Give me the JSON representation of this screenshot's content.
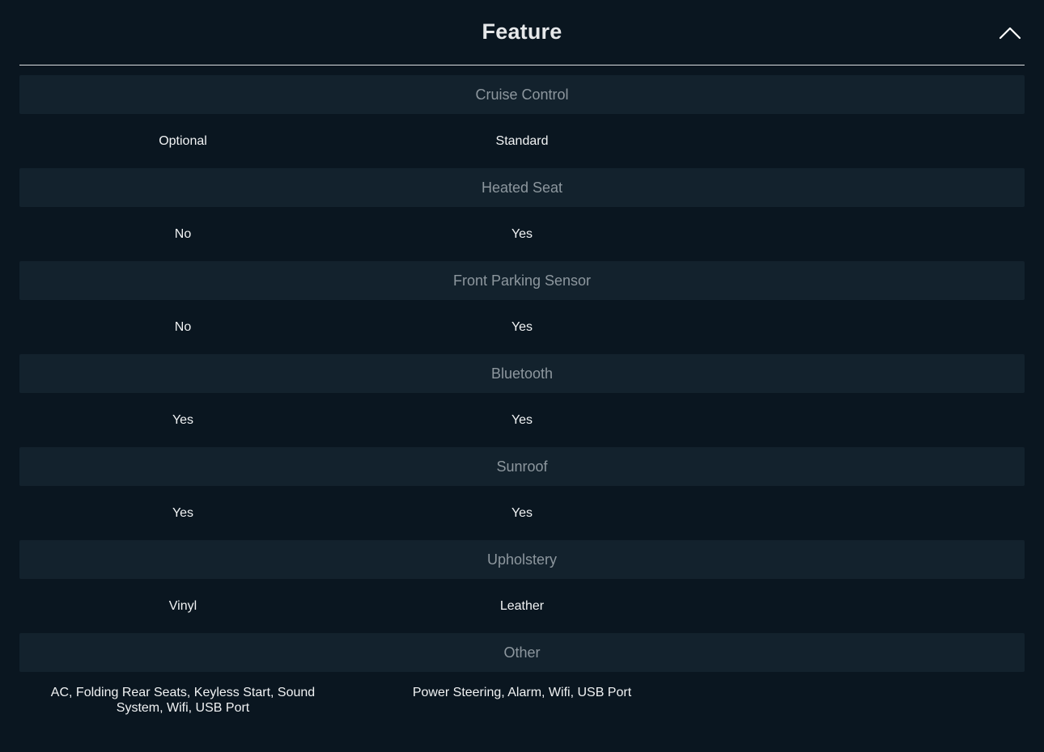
{
  "header": {
    "title": "Feature",
    "collapse_icon": "chevron-up-icon"
  },
  "colors": {
    "background": "#0a1620",
    "section_header_bg": "#13222d",
    "section_header_text": "#8d979e",
    "value_text": "#f1f3f4"
  },
  "sections": [
    {
      "label": "Cruise Control",
      "values": [
        "Optional",
        "Standard"
      ]
    },
    {
      "label": "Heated Seat",
      "values": [
        "No",
        "Yes"
      ]
    },
    {
      "label": "Front Parking Sensor",
      "values": [
        "No",
        "Yes"
      ]
    },
    {
      "label": "Bluetooth",
      "values": [
        "Yes",
        "Yes"
      ]
    },
    {
      "label": "Sunroof",
      "values": [
        "Yes",
        "Yes"
      ]
    },
    {
      "label": "Upholstery",
      "values": [
        "Vinyl",
        "Leather"
      ]
    },
    {
      "label": "Other",
      "values": [
        "AC, Folding Rear Seats, Keyless Start, Sound System, Wifi, USB Port",
        "Power Steering, Alarm, Wifi, USB Port"
      ]
    }
  ]
}
